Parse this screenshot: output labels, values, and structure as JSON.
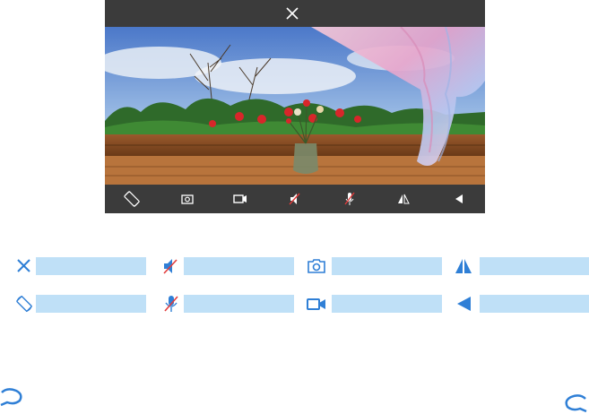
{
  "colors": {
    "accent": "#2f7fd6",
    "legend_bar": "#bfe0f7",
    "toolbar_bg": "#3b3b3b",
    "icon_light": "#ffffff",
    "mute_red": "#e23b3b"
  },
  "preview": {
    "top_bar": {
      "close_icon": "close-icon"
    },
    "scene": {
      "description_icon": "live-video-frame"
    },
    "bottom_bar": {
      "buttons": [
        {
          "icon": "rotate-icon"
        },
        {
          "icon": "snapshot-icon"
        },
        {
          "icon": "record-video-icon"
        },
        {
          "icon": "speaker-mute-icon"
        },
        {
          "icon": "microphone-mute-icon"
        },
        {
          "icon": "flip-icon"
        },
        {
          "icon": "back-icon"
        }
      ]
    }
  },
  "legend": {
    "row1": [
      {
        "icon": "close-icon",
        "label": ""
      },
      {
        "icon": "speaker-mute-icon",
        "label": ""
      },
      {
        "icon": "snapshot-icon",
        "label": ""
      },
      {
        "icon": "flip-icon",
        "label": ""
      }
    ],
    "row2": [
      {
        "icon": "rotate-icon",
        "label": ""
      },
      {
        "icon": "microphone-mute-icon",
        "label": ""
      },
      {
        "icon": "record-video-icon",
        "label": ""
      },
      {
        "icon": "back-icon",
        "label": ""
      }
    ]
  },
  "corners": {
    "left": "page-corner-mark-left",
    "right": "page-corner-mark-right"
  }
}
